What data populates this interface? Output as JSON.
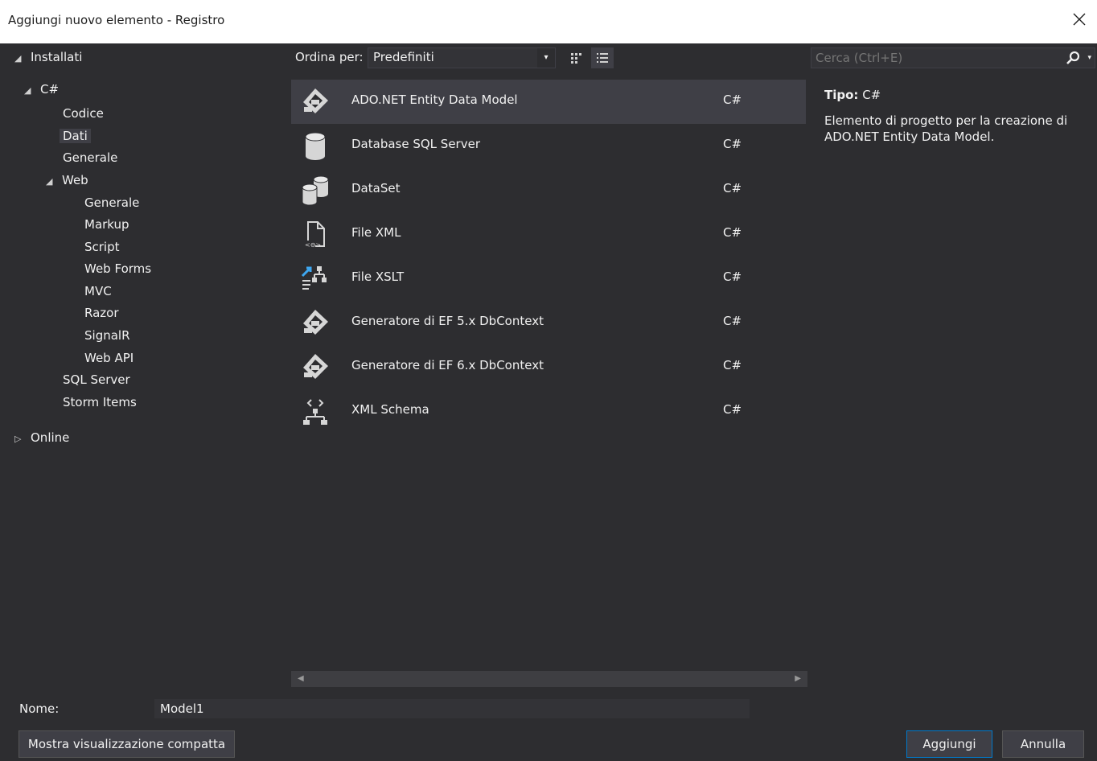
{
  "window": {
    "title": "Aggiungi nuovo elemento - Registro"
  },
  "tree": [
    {
      "label": "Installati",
      "arrow": "◢"
    },
    {
      "label": "C#",
      "arrow": "◢"
    },
    {
      "label": "Codice"
    },
    {
      "label": "Dati"
    },
    {
      "label": "Generale"
    },
    {
      "label": "Web",
      "arrow": "◢"
    },
    {
      "label": "Generale"
    },
    {
      "label": "Markup"
    },
    {
      "label": "Script"
    },
    {
      "label": "Web Forms"
    },
    {
      "label": "MVC"
    },
    {
      "label": "Razor"
    },
    {
      "label": "SignalR"
    },
    {
      "label": "Web API"
    },
    {
      "label": "SQL Server"
    },
    {
      "label": "Storm Items"
    },
    {
      "label": "Online",
      "arrow": "▷"
    }
  ],
  "toolbar": {
    "sort_label": "Ordina per:",
    "sort_value": "Predefiniti",
    "sort_arrow": "▾"
  },
  "items": [
    {
      "name": "ADO.NET Entity Data Model",
      "lang": "C#",
      "icon": "entity-model-icon"
    },
    {
      "name": "Database SQL Server",
      "lang": "C#",
      "icon": "database-icon"
    },
    {
      "name": "DataSet",
      "lang": "C#",
      "icon": "dataset-icon"
    },
    {
      "name": "File XML",
      "lang": "C#",
      "icon": "xml-file-icon"
    },
    {
      "name": "File XSLT",
      "lang": "C#",
      "icon": "xslt-file-icon"
    },
    {
      "name": "Generatore di EF 5.x DbContext",
      "lang": "C#",
      "icon": "ef-generator-icon"
    },
    {
      "name": "Generatore di EF 6.x DbContext",
      "lang": "C#",
      "icon": "ef-generator-icon"
    },
    {
      "name": "XML Schema",
      "lang": "C#",
      "icon": "xml-schema-icon"
    }
  ],
  "search": {
    "placeholder": "Cerca (Ctrl+E)",
    "dropdown": "▾"
  },
  "details": {
    "type_label": "Tipo:",
    "type_value": "C#",
    "description": "Elemento di progetto per la creazione di ADO.NET Entity Data Model."
  },
  "scroll": {
    "left": "◀",
    "right": "▶"
  },
  "name_field": {
    "label": "Nome:",
    "value": "Model1"
  },
  "buttons": {
    "compact": "Mostra visualizzazione compatta",
    "add": "Aggiungi",
    "cancel": "Annulla"
  },
  "colors": {
    "accent": "#007acc",
    "background": "#2d2d30",
    "selection": "#3f3f46",
    "xslt_arrow": "#3ea7f0"
  }
}
